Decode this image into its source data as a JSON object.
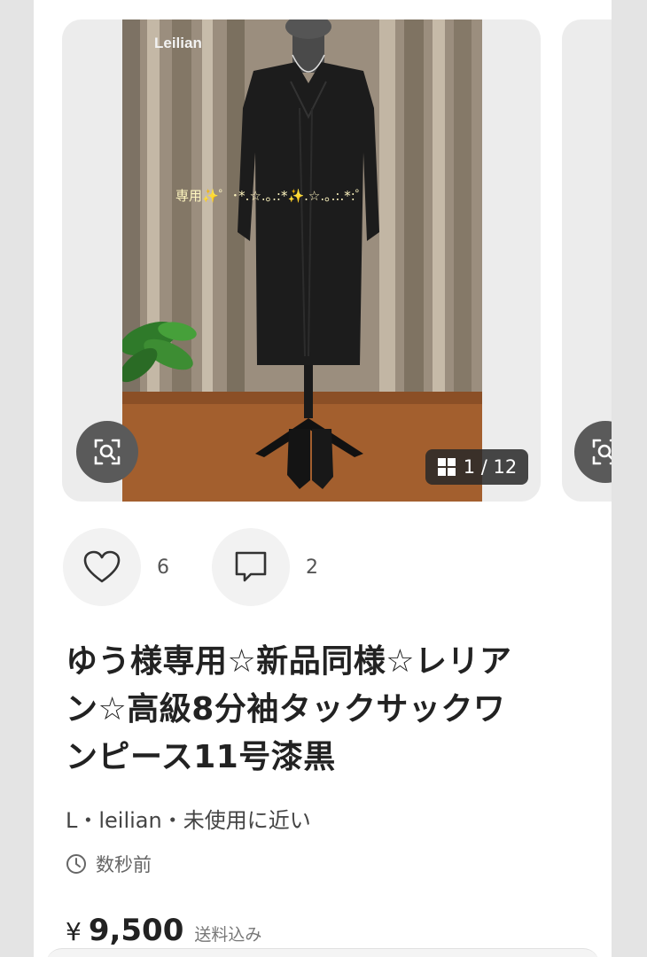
{
  "gallery": {
    "watermark": "Leilian",
    "overlay_caption": "専用✨゜･*.☆.｡.:*✨.☆.｡.:.*:゜",
    "counter": "1 / 12",
    "zoom_icon": "image-search-icon",
    "grid_icon": "grid-icon"
  },
  "reactions": {
    "like_icon": "heart-icon",
    "like_count": "6",
    "comment_icon": "comment-icon",
    "comment_count": "2"
  },
  "item": {
    "title_line1": "ゆう様専用☆新品同様☆レリア",
    "title_line2": "ン☆高級8分袖タックサックワ",
    "title_line3": "ンピース11号漆黒",
    "meta": "L・leilian・未使用に近い",
    "time_icon": "clock-icon",
    "time": "数秒前",
    "currency": "¥",
    "price": "9,500",
    "shipping": "送料込み"
  }
}
